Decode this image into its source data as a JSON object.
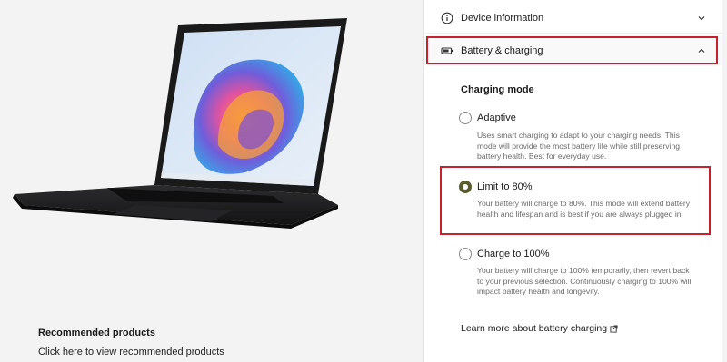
{
  "recommended": {
    "title": "Recommended products",
    "link": "Click here to view recommended products"
  },
  "panel": {
    "device_info": {
      "label": "Device information",
      "icon": "info-icon"
    },
    "battery": {
      "label": "Battery & charging",
      "icon": "battery-icon"
    },
    "section_title": "Charging mode",
    "options": [
      {
        "label": "Adaptive",
        "selected": false,
        "description": "Uses smart charging to adapt to your charging needs. This mode will provide the most battery life while still preserving battery health. Best for everyday use."
      },
      {
        "label": "Limit to 80%",
        "selected": true,
        "description": "Your battery will charge to 80%. This mode will extend battery health and lifespan and is best if you are always plugged in."
      },
      {
        "label": "Charge to 100%",
        "selected": false,
        "description": "Your battery will charge to 100% temporarily, then revert back to your previous selection. Continuously charging to 100% will impact battery health and longevity."
      }
    ],
    "learn_more": "Learn more about battery charging"
  },
  "colors": {
    "highlight": "#c5222d",
    "radio_selected": "#5b5b2e"
  }
}
